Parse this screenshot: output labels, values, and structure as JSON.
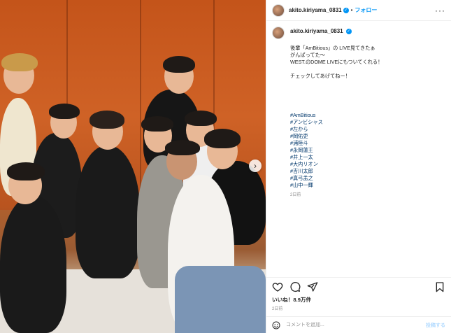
{
  "photo": {
    "alt_icon": "person-group",
    "next_icon": "chevron-right-icon",
    "next_glyph": "›"
  },
  "header": {
    "username": "akito.kiriyama_0831",
    "separator": "•",
    "follow_label": "フォロー",
    "more_glyph": "···"
  },
  "caption": {
    "username": "akito.kiriyama_0831",
    "lines": [
      "後輩「AmBitious」の LIVE見てきたぁ",
      "がんばってた〜",
      "WEST.のDOME LIVEにもついてくれる！",
      "",
      "チェックしてあげてねー！"
    ],
    "hashtags": [
      "#AmBitious",
      "#アンビシャス",
      "#左から",
      "#岡佑吏",
      "#浦陸斗",
      "#永岡蓮王",
      "#井上一太",
      "#大内リオン",
      "#吉川太郎",
      "#真弓孟之",
      "#山中一輝"
    ],
    "time": "2日前"
  },
  "stats": {
    "likes": "いいね！8.9万件",
    "posted": "2日前"
  },
  "comment": {
    "placeholder": "コメントを追加...",
    "post_label": "投稿する"
  },
  "colors": {
    "accent": "#0095f6",
    "hashtag": "#00376b",
    "wall": "#c9591f"
  }
}
